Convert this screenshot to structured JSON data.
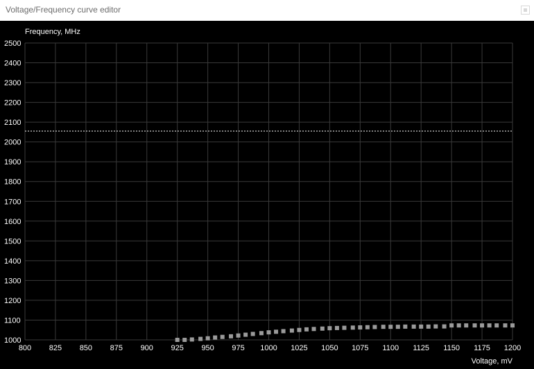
{
  "window": {
    "title": "Voltage/Frequency curve editor",
    "close_icon": "close-icon",
    "colors": {
      "titlebar_bg": "#ffffff",
      "title_text": "#6b6b6b",
      "plot_bg": "#000000",
      "grid": "#3a3a3a",
      "text": "#ffffff",
      "curve_point": "#9a9a9a",
      "limit_line": "#ffffff"
    }
  },
  "chart_data": {
    "type": "scatter",
    "title": "",
    "ylabel": "Frequency, MHz",
    "xlabel": "Voltage, mV",
    "xlim": [
      800,
      1200
    ],
    "ylim": [
      1000,
      2500
    ],
    "x_ticks": [
      800,
      825,
      850,
      875,
      900,
      925,
      950,
      975,
      1000,
      1025,
      1050,
      1075,
      1100,
      1125,
      1150,
      1175,
      1200
    ],
    "y_ticks": [
      1000,
      1100,
      1200,
      1300,
      1400,
      1500,
      1600,
      1700,
      1800,
      1900,
      2000,
      2100,
      2200,
      2300,
      2400,
      2500
    ],
    "grid": true,
    "limit_line": {
      "y": 2055,
      "style": "dotted"
    },
    "series": [
      {
        "x": [
          925,
          931,
          937,
          944,
          950,
          956,
          962,
          969,
          975,
          981,
          987,
          994,
          1000,
          1006,
          1012,
          1019,
          1025,
          1031,
          1037,
          1044,
          1050,
          1056,
          1062,
          1069,
          1075,
          1081,
          1087,
          1094,
          1100,
          1106,
          1112,
          1119,
          1125,
          1131,
          1137,
          1144,
          1150,
          1156,
          1162,
          1169,
          1175,
          1181,
          1187,
          1194,
          1200
        ],
        "y": [
          1000,
          1000,
          1002,
          1005,
          1008,
          1012,
          1015,
          1018,
          1022,
          1026,
          1030,
          1034,
          1038,
          1041,
          1044,
          1047,
          1050,
          1053,
          1055,
          1057,
          1059,
          1060,
          1061,
          1062,
          1063,
          1064,
          1065,
          1066,
          1066,
          1066,
          1067,
          1067,
          1067,
          1067,
          1068,
          1068,
          1073,
          1073,
          1073,
          1073,
          1073,
          1073,
          1073,
          1073,
          1073
        ]
      }
    ]
  }
}
